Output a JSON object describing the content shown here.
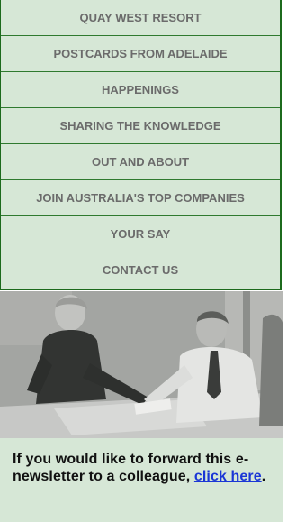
{
  "menu": {
    "items": [
      {
        "label": "QUAY WEST RESORT"
      },
      {
        "label": "POSTCARDS FROM ADELAIDE"
      },
      {
        "label": "HAPPENINGS"
      },
      {
        "label": "SHARING THE KNOWLEDGE"
      },
      {
        "label": "OUT AND ABOUT"
      },
      {
        "label": "JOIN AUSTRALIA'S TOP COMPANIES"
      },
      {
        "label": "YOUR SAY"
      },
      {
        "label": "CONTACT US"
      }
    ]
  },
  "forward_note": {
    "text_before": "If you would like to forward this e-newsletter to a colleague, ",
    "link_label": "click here",
    "text_after": "."
  },
  "colors": {
    "menu_background": "#d6e7d6",
    "menu_border": "#1c6a1c",
    "menu_text": "#6b6b6b",
    "link": "#1a36d6"
  }
}
